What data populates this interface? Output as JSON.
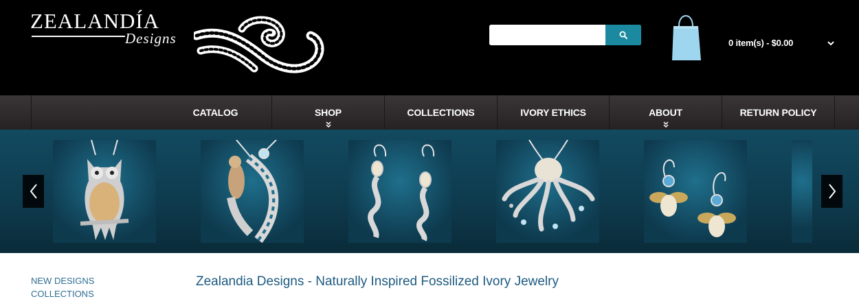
{
  "brand": {
    "name": "ZEALANDÍA",
    "tagline": "Designs"
  },
  "search": {
    "placeholder": "",
    "value": "",
    "icon": "search-icon"
  },
  "cart": {
    "summary": "0 item(s) - $0.00",
    "icon": "shopping-bag-icon",
    "bag_color": "#9fd6ef"
  },
  "nav": {
    "items": [
      {
        "label": "CATALOG"
      },
      {
        "label": "SHOP",
        "has_dropdown": true
      },
      {
        "label": "COLLECTIONS"
      },
      {
        "label": "IVORY ETHICS"
      },
      {
        "label": "ABOUT",
        "has_dropdown": true
      },
      {
        "label": "RETURN POLICY"
      }
    ]
  },
  "carousel": {
    "prev_icon": "chevron-left-icon",
    "next_icon": "chevron-right-icon",
    "slides": [
      {
        "subject": "owl-pendant"
      },
      {
        "subject": "mermaid-pendant"
      },
      {
        "subject": "filigree-earrings"
      },
      {
        "subject": "octopus-pendant"
      },
      {
        "subject": "bee-earrings"
      },
      {
        "subject": "partial"
      }
    ]
  },
  "sidebar": {
    "links": [
      "NEW DESIGNS",
      "COLLECTIONS"
    ]
  },
  "main": {
    "title": "Zealandia Designs - Naturally Inspired Fossilized Ivory Jewelry"
  },
  "colors": {
    "header_bg": "#000000",
    "accent": "#1b8aa0",
    "link": "#2d6f93",
    "title": "#1c5a80"
  }
}
